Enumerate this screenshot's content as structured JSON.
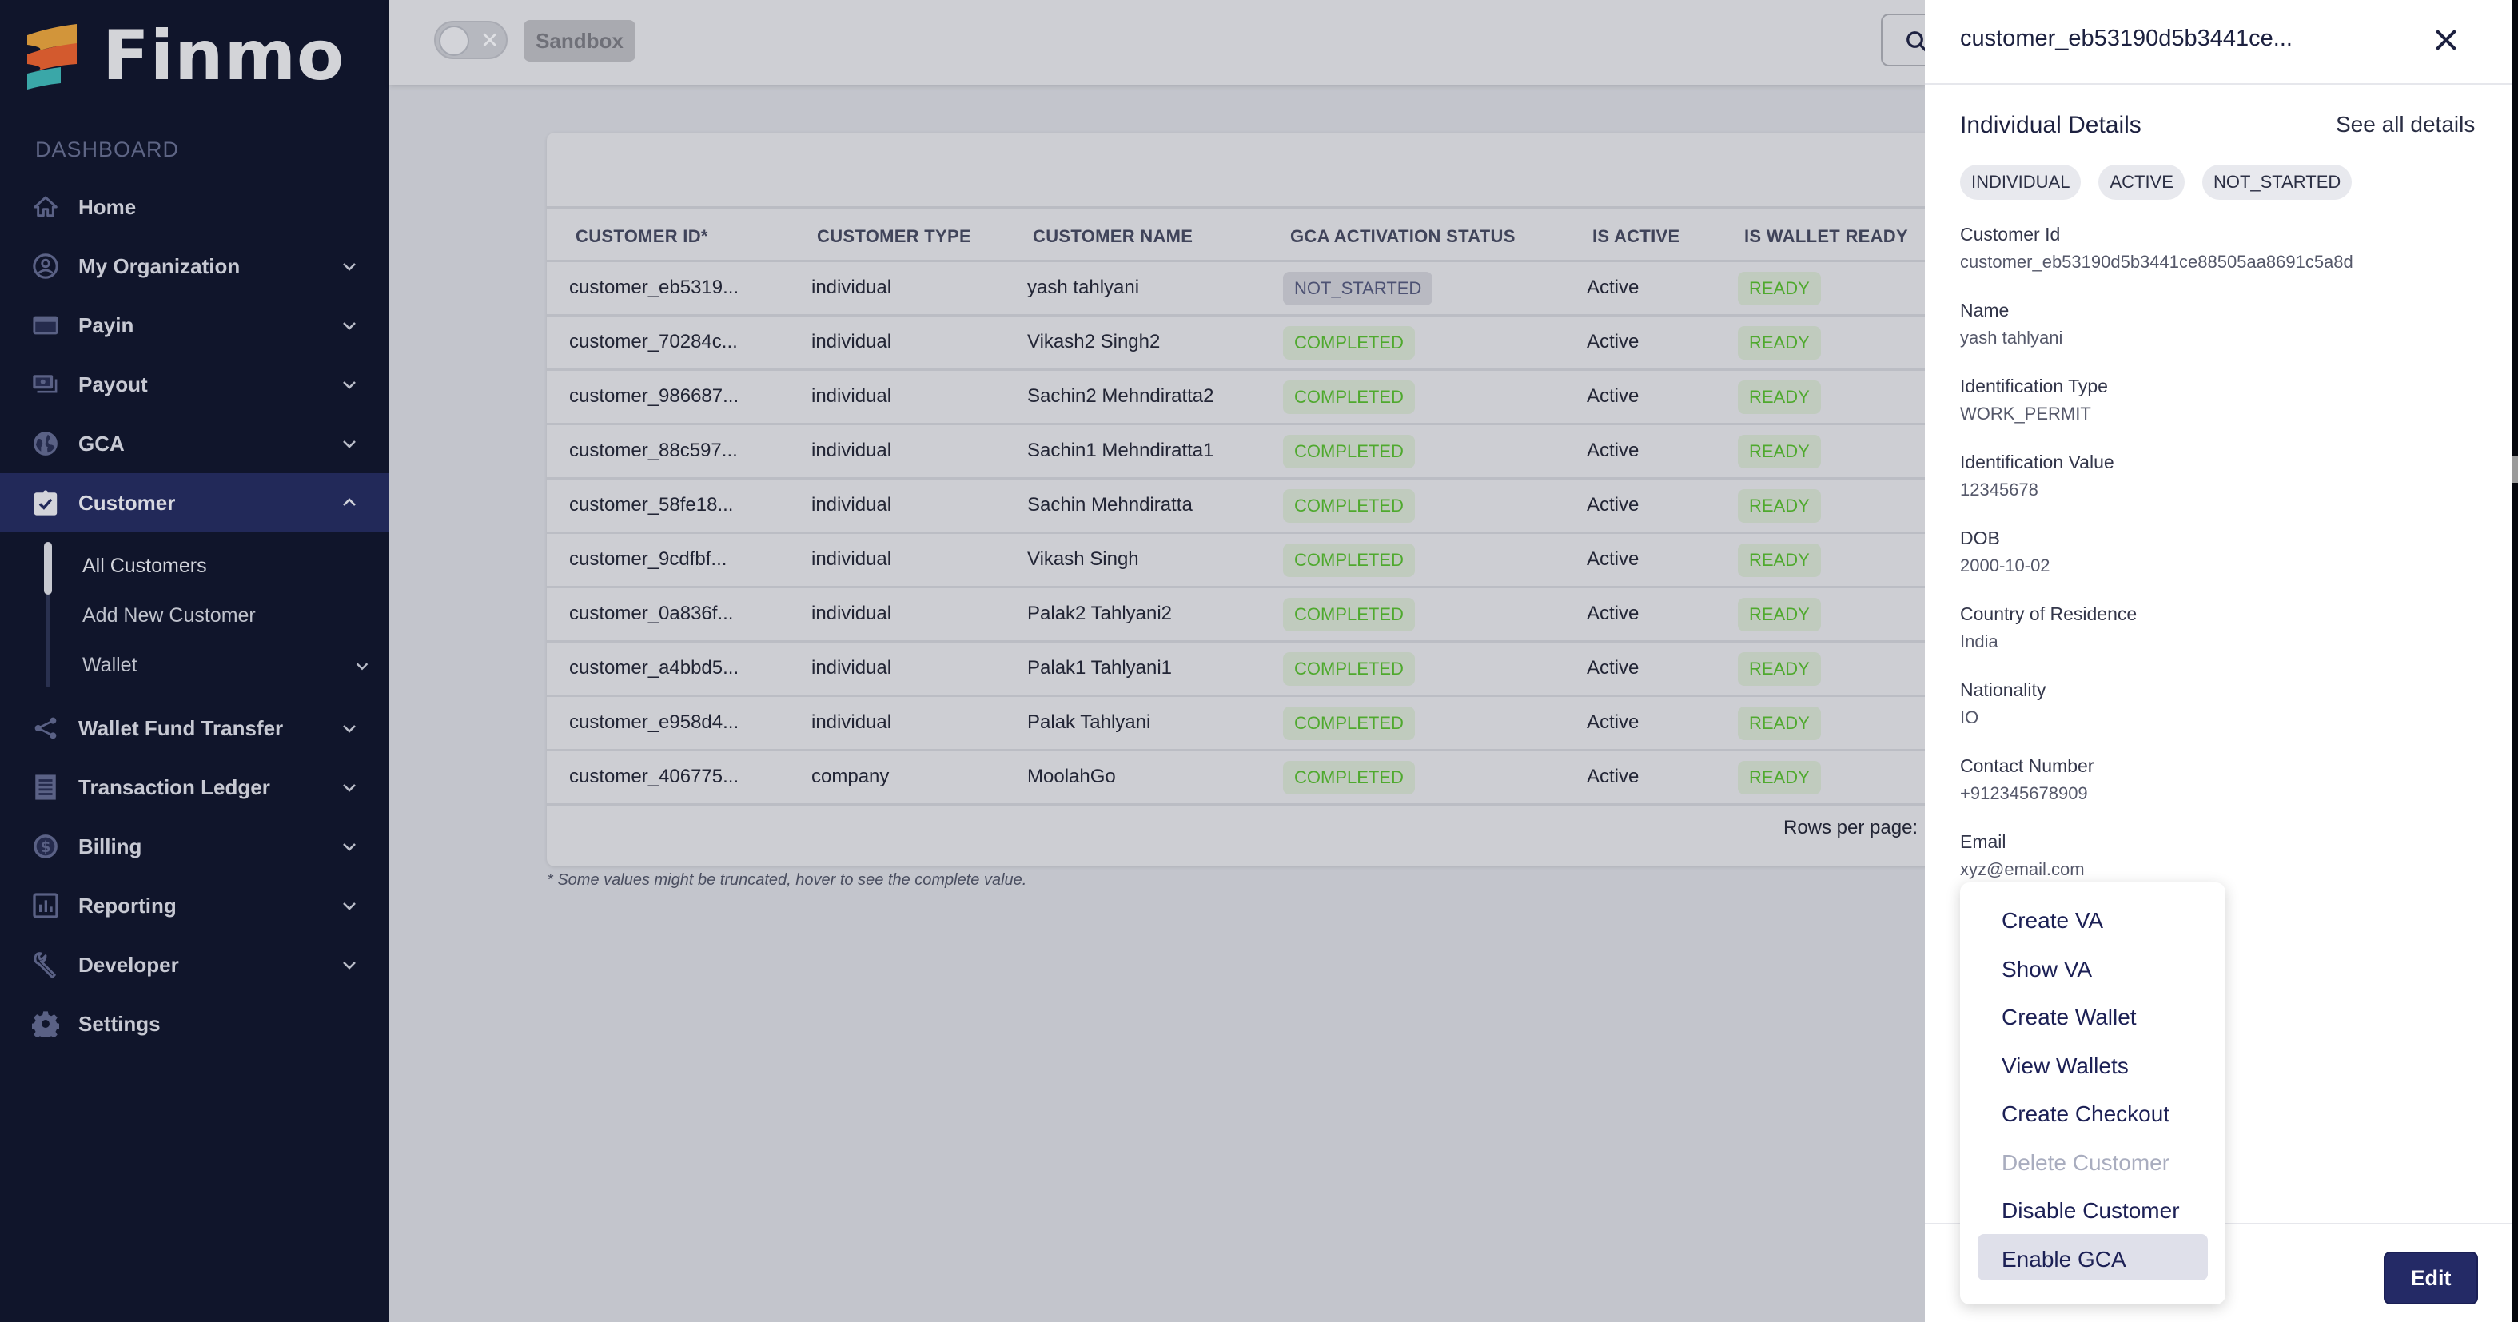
{
  "app": {
    "brand": "Finmo",
    "brand_colors": {
      "gold": "#d2953a",
      "orange": "#d35a2e",
      "teal": "#3aa7a8"
    }
  },
  "sidebar": {
    "section_label": "DASHBOARD",
    "items": [
      {
        "label": "Home",
        "icon": "home-icon",
        "expandable": false
      },
      {
        "label": "My Organization",
        "icon": "account-circle-icon",
        "expandable": true
      },
      {
        "label": "Payin",
        "icon": "credit-card-icon",
        "expandable": true
      },
      {
        "label": "Payout",
        "icon": "payments-icon",
        "expandable": true
      },
      {
        "label": "GCA",
        "icon": "globe-icon",
        "expandable": true
      },
      {
        "label": "Customer",
        "icon": "clipboard-check-icon",
        "expandable": true,
        "expanded": true,
        "active": true
      },
      {
        "label": "Wallet Fund Transfer",
        "icon": "share-icon",
        "expandable": true
      },
      {
        "label": "Transaction Ledger",
        "icon": "receipt-icon",
        "expandable": true
      },
      {
        "label": "Billing",
        "icon": "dollar-circle-icon",
        "expandable": true
      },
      {
        "label": "Reporting",
        "icon": "bar-chart-icon",
        "expandable": true
      },
      {
        "label": "Developer",
        "icon": "wrench-icon",
        "expandable": true
      },
      {
        "label": "Settings",
        "icon": "gear-icon",
        "expandable": false
      }
    ],
    "customer_subitems": [
      {
        "label": "All Customers",
        "active": true
      },
      {
        "label": "Add New Customer"
      },
      {
        "label": "Wallet",
        "expandable": true
      }
    ]
  },
  "topbar": {
    "environment_toggle": "off",
    "environment_label": "Sandbox"
  },
  "table": {
    "columns": [
      "CUSTOMER ID*",
      "CUSTOMER TYPE",
      "CUSTOMER NAME",
      "GCA ACTIVATION STATUS",
      "IS ACTIVE",
      "IS WALLET READY"
    ],
    "rows": [
      {
        "id": "customer_eb5319...",
        "type": "individual",
        "name": "yash tahlyani",
        "gca": "NOT_STARTED",
        "active": "Active",
        "wallet": "READY"
      },
      {
        "id": "customer_70284c...",
        "type": "individual",
        "name": "Vikash2 Singh2",
        "gca": "COMPLETED",
        "active": "Active",
        "wallet": "READY"
      },
      {
        "id": "customer_986687...",
        "type": "individual",
        "name": "Sachin2 Mehndiratta2",
        "gca": "COMPLETED",
        "active": "Active",
        "wallet": "READY"
      },
      {
        "id": "customer_88c597...",
        "type": "individual",
        "name": "Sachin1 Mehndiratta1",
        "gca": "COMPLETED",
        "active": "Active",
        "wallet": "READY"
      },
      {
        "id": "customer_58fe18...",
        "type": "individual",
        "name": "Sachin Mehndiratta",
        "gca": "COMPLETED",
        "active": "Active",
        "wallet": "READY"
      },
      {
        "id": "customer_9cdfbf...",
        "type": "individual",
        "name": "Vikash Singh",
        "gca": "COMPLETED",
        "active": "Active",
        "wallet": "READY"
      },
      {
        "id": "customer_0a836f...",
        "type": "individual",
        "name": "Palak2 Tahlyani2",
        "gca": "COMPLETED",
        "active": "Active",
        "wallet": "READY"
      },
      {
        "id": "customer_a4bbd5...",
        "type": "individual",
        "name": "Palak1 Tahlyani1",
        "gca": "COMPLETED",
        "active": "Active",
        "wallet": "READY"
      },
      {
        "id": "customer_e958d4...",
        "type": "individual",
        "name": "Palak Tahlyani",
        "gca": "COMPLETED",
        "active": "Active",
        "wallet": "READY"
      },
      {
        "id": "customer_406775...",
        "type": "company",
        "name": "MoolahGo",
        "gca": "COMPLETED",
        "active": "Active",
        "wallet": "READY"
      }
    ],
    "rows_per_page_label": "Rows per page:",
    "footnote": "* Some values might be truncated, hover to see the complete value."
  },
  "drawer": {
    "title": "customer_eb53190d5b3441ce...",
    "section_title": "Individual Details",
    "see_all_link": "See all details",
    "tags": [
      "INDIVIDUAL",
      "ACTIVE",
      "NOT_STARTED"
    ],
    "fields": [
      {
        "label": "Customer Id",
        "value": "customer_eb53190d5b3441ce88505aa8691c5a8d"
      },
      {
        "label": "Name",
        "value": "yash tahlyani"
      },
      {
        "label": "Identification Type",
        "value": "WORK_PERMIT"
      },
      {
        "label": "Identification Value",
        "value": "12345678"
      },
      {
        "label": "DOB",
        "value": "2000-10-02"
      },
      {
        "label": "Country of Residence",
        "value": "India"
      },
      {
        "label": "Nationality",
        "value": "IO"
      },
      {
        "label": "Contact Number",
        "value": "+912345678909"
      },
      {
        "label": "Email",
        "value": "xyz@email.com"
      }
    ],
    "edit_label": "Edit"
  },
  "action_menu": {
    "items": [
      {
        "label": "Create VA"
      },
      {
        "label": "Show VA"
      },
      {
        "label": "Create Wallet"
      },
      {
        "label": "View Wallets"
      },
      {
        "label": "Create Checkout"
      },
      {
        "label": "Delete Customer",
        "disabled": true
      },
      {
        "label": "Disable Customer"
      },
      {
        "label": "Enable GCA",
        "highlighted": true
      }
    ]
  }
}
